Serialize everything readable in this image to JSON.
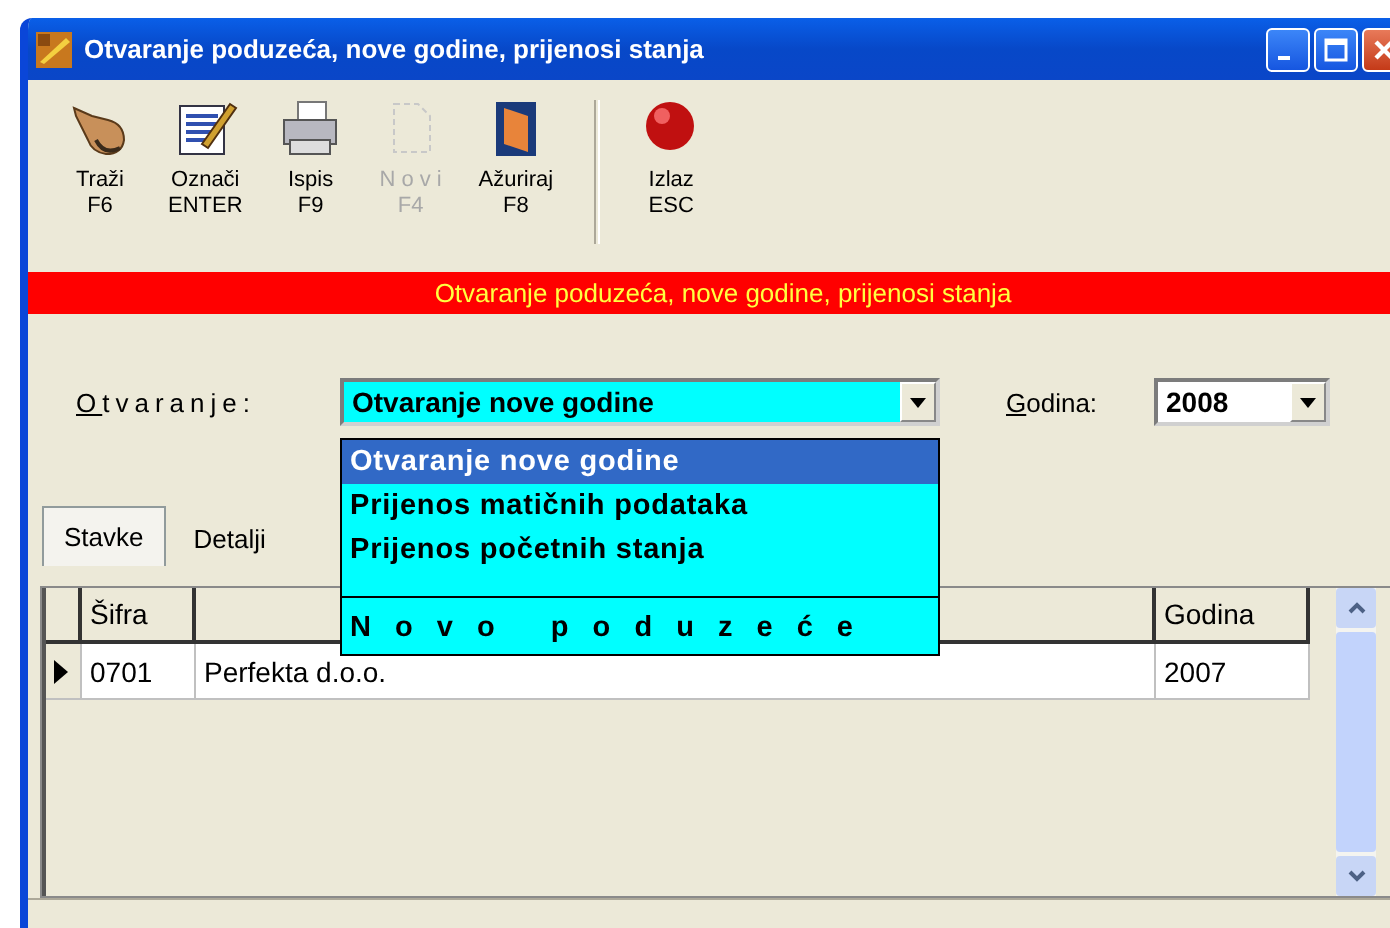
{
  "window": {
    "title": "Otvaranje poduzeća, nove godine, prijenosi stanja"
  },
  "toolbar": [
    {
      "label": "Traži",
      "key": "F6",
      "disabled": false,
      "divider_before": false
    },
    {
      "label": "Označi",
      "key": "ENTER",
      "disabled": false,
      "divider_before": false
    },
    {
      "label": "Ispis",
      "key": "F9",
      "disabled": false,
      "divider_before": false
    },
    {
      "label": "N o v i",
      "key": "F4",
      "disabled": true,
      "divider_before": false
    },
    {
      "label": "Ažuriraj",
      "key": "F8",
      "disabled": false,
      "divider_before": false
    },
    {
      "label": "Izlaz",
      "key": "ESC",
      "disabled": false,
      "divider_before": true
    }
  ],
  "banner": "Otvaranje poduzeća, nove godine, prijenosi stanja",
  "otvaranje": {
    "label": "Otvaranje:",
    "value": "Otvaranje nove godine"
  },
  "dropdown": [
    {
      "label": "Otvaranje nove godine",
      "selected": true,
      "kind": "option"
    },
    {
      "label": "Prijenos matičnih podataka",
      "selected": false,
      "kind": "option"
    },
    {
      "label": "Prijenos početnih stanja",
      "selected": false,
      "kind": "option"
    },
    {
      "label": "N o v o   p o d u z e ć e",
      "selected": false,
      "kind": "divided"
    }
  ],
  "godina": {
    "label": "Godina:",
    "value": "2008"
  },
  "tabs": [
    {
      "label": "Stavke",
      "selected": true
    },
    {
      "label": "Detalji",
      "selected": false
    }
  ],
  "table": {
    "headers": {
      "sifra": "Šifra",
      "godina": "Godina"
    },
    "rows": [
      {
        "sifra": "0701",
        "column_2": "Perfekta d.o.o.",
        "godina": "2007",
        "current": true
      }
    ]
  }
}
